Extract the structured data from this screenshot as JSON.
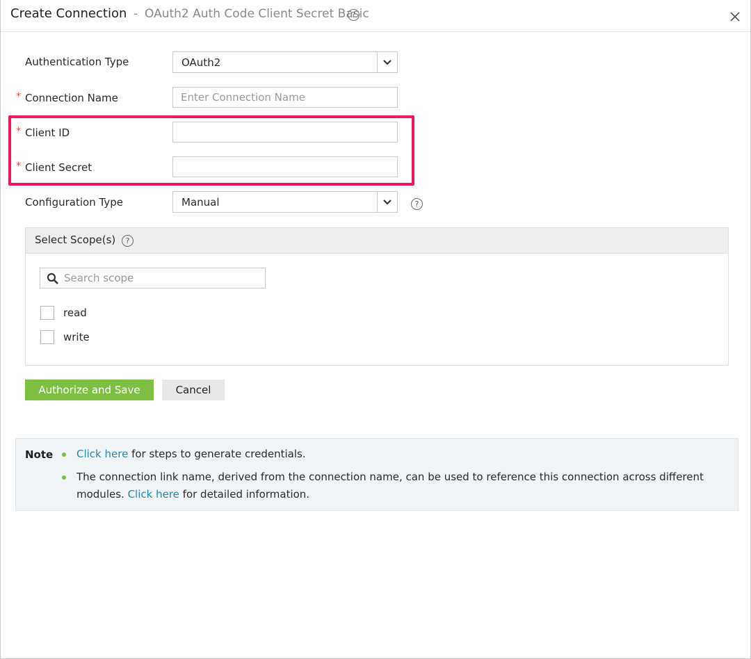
{
  "header": {
    "title": "Create Connection",
    "separator": "-",
    "subtitle": "OAuth2 Auth Code Client Secret Basic",
    "help_glyph": "?",
    "close_icon": "close-icon"
  },
  "form": {
    "required_marker": "*",
    "auth_type": {
      "label": "Authentication Type",
      "value": "OAuth2"
    },
    "connection_name": {
      "label": "Connection Name",
      "placeholder": "Enter Connection Name",
      "value": ""
    },
    "client_id": {
      "label": "Client ID",
      "value": ""
    },
    "client_secret": {
      "label": "Client Secret",
      "value": ""
    },
    "config_type": {
      "label": "Configuration Type",
      "value": "Manual"
    }
  },
  "scopes": {
    "title": "Select Scope(s)",
    "search_placeholder": "Search scope",
    "items": [
      {
        "label": "read",
        "checked": false
      },
      {
        "label": "write",
        "checked": false
      }
    ]
  },
  "actions": {
    "primary_label": "Authorize and Save",
    "cancel_label": "Cancel"
  },
  "note": {
    "label": "Note",
    "items": [
      {
        "link": "Click here",
        "text": " for steps to generate credentials."
      },
      {
        "line1": "The connection link name, derived from the connection name, can be used to reference this connection across different",
        "line2_prefix": "modules. ",
        "link": "Click here",
        "line2_suffix": " for detailed information."
      }
    ]
  },
  "colors": {
    "highlight": "#ef1565",
    "primary_button": "#7cbf42",
    "link": "#2486b3",
    "required": "#d9534f"
  }
}
